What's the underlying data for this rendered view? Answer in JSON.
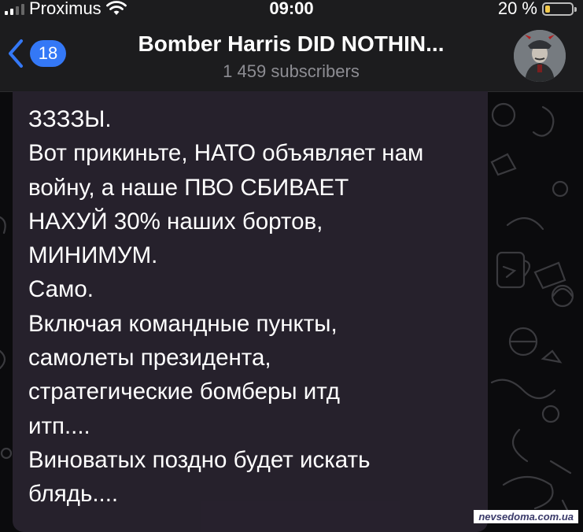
{
  "status_bar": {
    "carrier": "Proximus",
    "time": "09:00",
    "battery_percent": "20 %",
    "battery_level": 0.2
  },
  "header": {
    "back_badge": "18",
    "title": "Bomber Harris DID NOTHIN...",
    "subtitle": "1 459 subscribers"
  },
  "message": {
    "lines": [
      "ЗЗЗЗЫ.",
      "Вот прикиньте, НАТО объявляет нам",
      "войну, а наше ПВО СБИВАЕТ",
      "НАХУЙ 30% наших бортов,",
      "МИНИМУМ.",
      "Само.",
      "Включая командные пункты,",
      "самолеты президента,",
      "стратегические бомберы итд",
      "итп....",
      "Виноватых поздно будет искать",
      "блядь...."
    ]
  },
  "watermark": "nevsedoma.com.ua",
  "colors": {
    "accent": "#3478f6",
    "header_bg": "#1c1c1e",
    "bubble_bg": "#28222e",
    "battery": "#f2c94c"
  }
}
